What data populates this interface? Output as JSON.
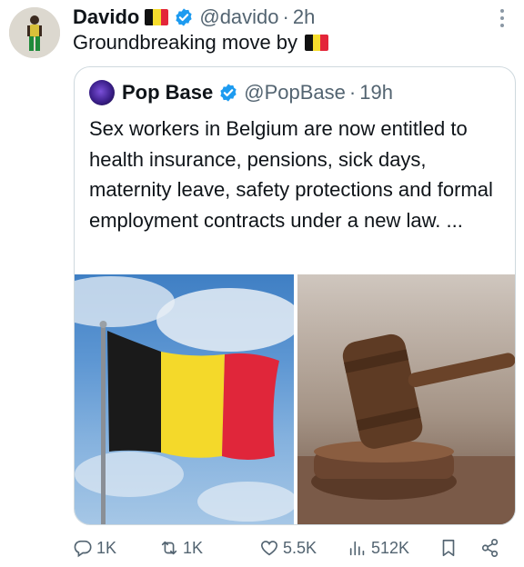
{
  "author": {
    "name": "Davido",
    "handle": "@davido",
    "time": "2h",
    "text": "Groundbreaking move by"
  },
  "quoted": {
    "name": "Pop Base",
    "handle": "@PopBase",
    "time": "19h",
    "text": "Sex workers in Belgium are now entitled to health insurance, pensions, sick days, maternity leave, safety protections and formal employment contracts under a new law. ..."
  },
  "actions": {
    "replies": "1K",
    "reposts": "1K",
    "likes": "5.5K",
    "views": "512K"
  },
  "colors": {
    "text": "#0f1419",
    "secondary": "#536471",
    "verified": "#1d9bf0",
    "border": "#cfd9de",
    "flag_black": "#111111",
    "flag_yellow": "#f6dc2d",
    "flag_red": "#e3263a"
  },
  "icons": [
    "belgium-flag-icon",
    "verified-badge-icon",
    "more-options-icon",
    "reply-icon",
    "repost-icon",
    "like-icon",
    "views-icon",
    "bookmark-icon",
    "share-icon"
  ]
}
